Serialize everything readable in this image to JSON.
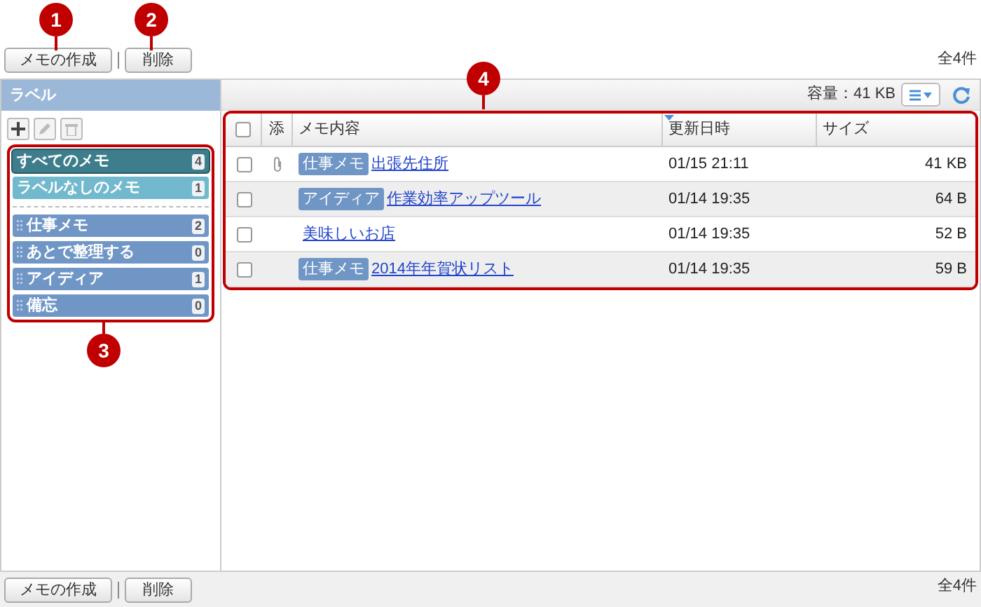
{
  "callouts": [
    "1",
    "2",
    "3",
    "4"
  ],
  "toolbar": {
    "buttons": [
      "メモの作成",
      "削除"
    ],
    "total": "全4件"
  },
  "sidebar": {
    "title": "ラベル",
    "labels": [
      {
        "kind": "system",
        "name": "すべてのメモ",
        "count": "4",
        "color": "#3d7d8c",
        "selected": true
      },
      {
        "kind": "system",
        "name": "ラベルなしのメモ",
        "count": "1",
        "color": "#72b9cd",
        "selected": false
      },
      {
        "kind": "user",
        "name": "仕事メモ",
        "count": "2",
        "color": "#7096c6",
        "selected": false
      },
      {
        "kind": "user",
        "name": "あとで整理する",
        "count": "0",
        "color": "#7096c6",
        "selected": false
      },
      {
        "kind": "user",
        "name": "アイディア",
        "count": "1",
        "color": "#7096c6",
        "selected": false
      },
      {
        "kind": "user",
        "name": "備忘",
        "count": "0",
        "color": "#7096c6",
        "selected": false
      }
    ]
  },
  "capacity": "容量：41 KB",
  "table": {
    "all_checked": false,
    "columns": [
      {
        "label": "添",
        "sorted": false
      },
      {
        "label": "メモ内容",
        "sorted": false
      },
      {
        "label": "更新日時",
        "sorted": true
      },
      {
        "label": "サイズ",
        "sorted": false
      }
    ],
    "rows": [
      {
        "checked": false,
        "attachment": true,
        "label": "仕事メモ",
        "title": "出張先住所",
        "date": "01/15 21:11",
        "size": "41 KB"
      },
      {
        "checked": false,
        "attachment": false,
        "label": "アイディア",
        "title": "作業効率アップツール",
        "date": "01/14 19:35",
        "size": "64 B"
      },
      {
        "checked": false,
        "attachment": false,
        "title": "美味しいお店",
        "date": "01/14 19:35",
        "size": "52 B"
      },
      {
        "checked": false,
        "attachment": false,
        "label": "仕事メモ",
        "title": "2014年年賀状リスト",
        "date": "01/14 19:35",
        "size": "59 B"
      }
    ]
  },
  "bottom_toolbar": {
    "buttons": [
      "メモの作成",
      "削除"
    ],
    "total": "全4件"
  }
}
